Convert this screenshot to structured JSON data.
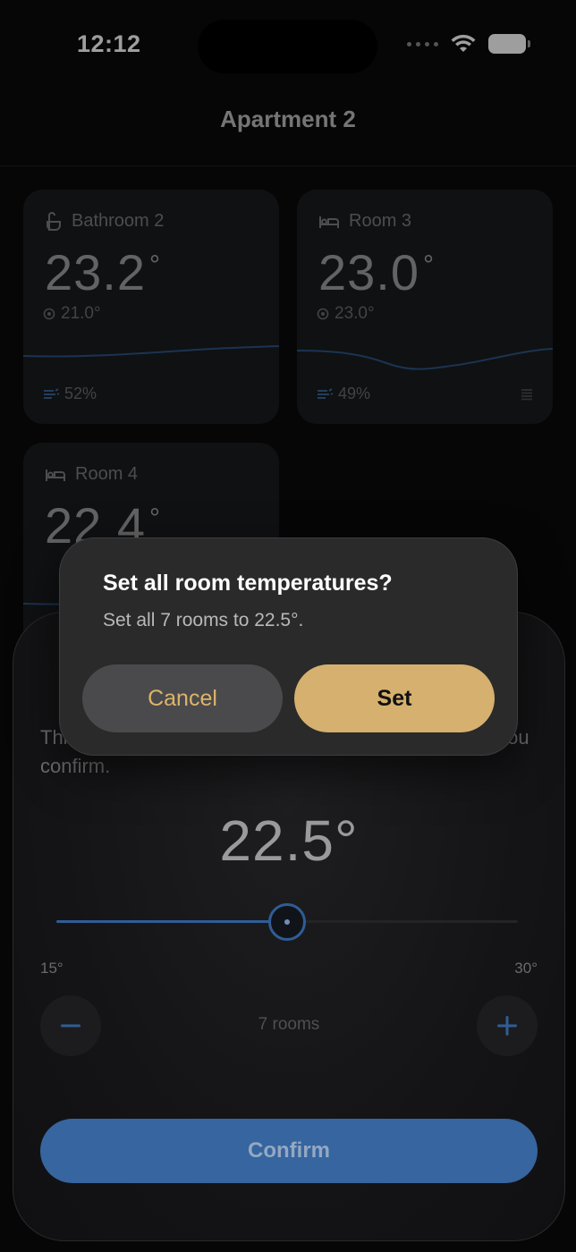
{
  "status_bar": {
    "time": "12:12"
  },
  "nav": {
    "title": "Apartment 2"
  },
  "rooms": [
    {
      "name": "Bathroom 2",
      "icon": "bath-icon",
      "temp": "23.2",
      "deg": "°",
      "target": "21.0°",
      "humidity": "52%"
    },
    {
      "name": "Room 3",
      "icon": "bed-icon",
      "temp": "23.0",
      "deg": "°",
      "target": "23.0°",
      "humidity": "49%"
    },
    {
      "name": "Room 4",
      "icon": "bed-icon",
      "temp": "22.4",
      "deg": "°"
    }
  ],
  "sheet": {
    "description": "This will set all rooms to the same temperature after you confirm.",
    "value": "22.5°",
    "slider": {
      "min": 15,
      "max": 30,
      "value": 22.5,
      "min_label": "15°",
      "max_label": "30°"
    },
    "rooms_count": "7 rooms",
    "confirm_label": "Confirm"
  },
  "alert": {
    "title": "Set all room temperatures?",
    "message": "Set all 7 rooms to 22.5°.",
    "cancel_label": "Cancel",
    "set_label": "Set"
  },
  "colors": {
    "accent_gold": "#d5b06e",
    "accent_blue": "#36659f",
    "background": "#0a0a0a"
  }
}
